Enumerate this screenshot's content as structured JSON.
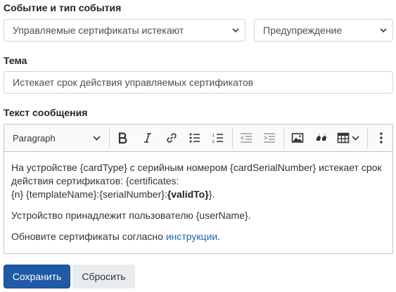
{
  "event_section": {
    "label": "Событие и тип события",
    "event_select": "Управляемые сертификаты истекают",
    "type_select": "Предупреждение"
  },
  "subject_section": {
    "label": "Тема",
    "value": "Истекает срок действия управляемых сертификатов"
  },
  "message_section": {
    "label": "Текст сообщения",
    "toolbar": {
      "paragraph_label": "Paragraph",
      "icons": [
        "bold-icon",
        "italic-icon",
        "link-icon",
        "bulleted-list-icon",
        "numbered-list-icon",
        "outdent-icon",
        "indent-icon",
        "image-icon",
        "quote-icon",
        "table-icon",
        "more-icon"
      ]
    },
    "content": {
      "p1_line1": "На устройстве {cardType} с серийным номером {cardSerialNumber} истекает срок",
      "p1_line2": "действия сертификатов: {certificates:",
      "p1_line3_pre": "{n} {templateName}:{serialNumber}:",
      "p1_line3_bold": "{validTo}",
      "p1_line3_post": "}.",
      "p2": "Устройство принадлежит пользователю {userName}.",
      "p3_pre": "Обновите сертификаты согласно ",
      "p3_link": "инструкции",
      "p3_post": "."
    }
  },
  "actions": {
    "save": "Сохранить",
    "reset": "Сбросить"
  },
  "colors": {
    "primary_button": "#1f5aa6",
    "link": "#1f67b0",
    "secondary_button": "#e9ecef"
  }
}
